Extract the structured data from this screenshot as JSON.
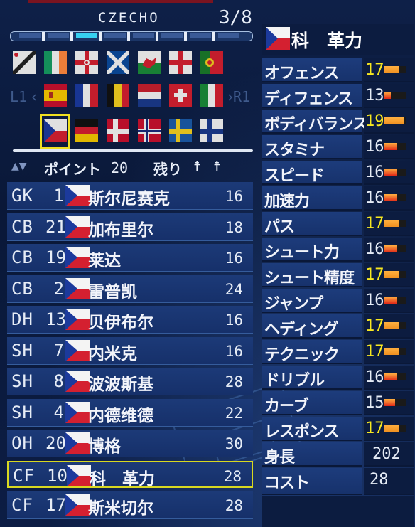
{
  "team": {
    "name": "CZECHO",
    "page": "3/8",
    "active_page_index": 3,
    "total_pages": 8
  },
  "flags": {
    "nav_left_label": "L1",
    "nav_right_label": "R1",
    "row1": [
      "england-flag",
      "ireland-flag",
      "northern-ireland-flag",
      "scotland-flag",
      "wales-flag",
      "england-cross-flag",
      "portugal-flag"
    ],
    "row2": [
      "spain-flag",
      "france-flag",
      "belgium-flag",
      "netherlands-flag",
      "switzerland-flag",
      "italy-flag"
    ],
    "row3": [
      "czech-flag",
      "germany-flag",
      "denmark-flag",
      "norway-flag",
      "sweden-flag",
      "finland-flag"
    ],
    "selected": "czech-flag"
  },
  "points": {
    "label": "ポイント",
    "value": "20",
    "remaining_label": "残り"
  },
  "players": [
    {
      "pos": "GK",
      "num": "1",
      "name": "斯尔尼赛克",
      "cost": "16"
    },
    {
      "pos": "CB",
      "num": "21",
      "name": "加布里尔",
      "cost": "18"
    },
    {
      "pos": "CB",
      "num": "19",
      "name": "莱达",
      "cost": "16"
    },
    {
      "pos": "CB",
      "num": "2",
      "name": "雷普凯",
      "cost": "24"
    },
    {
      "pos": "DH",
      "num": "13",
      "name": "贝伊布尔",
      "cost": "16"
    },
    {
      "pos": "SH",
      "num": "7",
      "name": "内米克",
      "cost": "16"
    },
    {
      "pos": "SH",
      "num": "8",
      "name": "波波斯基",
      "cost": "28"
    },
    {
      "pos": "SH",
      "num": "4",
      "name": "内德维德",
      "cost": "22"
    },
    {
      "pos": "OH",
      "num": "20",
      "name": "博格",
      "cost": "30"
    },
    {
      "pos": "CF",
      "num": "10",
      "name": "科　革力",
      "cost": "28",
      "selected": true
    },
    {
      "pos": "CF",
      "num": "17",
      "name": "斯米切尔",
      "cost": "28"
    }
  ],
  "selected_player": {
    "name": "科　革力",
    "stats": [
      {
        "label": "オフェンス",
        "value": "17",
        "hi": true
      },
      {
        "label": "ディフェンス",
        "value": "13",
        "hi": false
      },
      {
        "label": "ボディバランス",
        "value": "19",
        "hi": true
      },
      {
        "label": "スタミナ",
        "value": "16",
        "hi": false
      },
      {
        "label": "スピード",
        "value": "16",
        "hi": false
      },
      {
        "label": "加速力",
        "value": "16",
        "hi": false
      },
      {
        "label": "パス",
        "value": "17",
        "hi": true
      },
      {
        "label": "シュート力",
        "value": "16",
        "hi": false
      },
      {
        "label": "シュート精度",
        "value": "17",
        "hi": true
      },
      {
        "label": "ジャンプ",
        "value": "16",
        "hi": false
      },
      {
        "label": "ヘディング",
        "value": "17",
        "hi": true
      },
      {
        "label": "テクニック",
        "value": "17",
        "hi": true
      },
      {
        "label": "ドリブル",
        "value": "16",
        "hi": false
      },
      {
        "label": "カーブ",
        "value": "15",
        "hi": false
      },
      {
        "label": "レスポンス",
        "value": "17",
        "hi": true
      }
    ],
    "height_label": "身長",
    "height": "202",
    "cost_label": "コスト",
    "cost": "28"
  },
  "colors": {
    "highlight": "#f8e820",
    "selection_border": "#d8d820",
    "bar_red": "#e02818",
    "bar_orange": "#f09020"
  }
}
